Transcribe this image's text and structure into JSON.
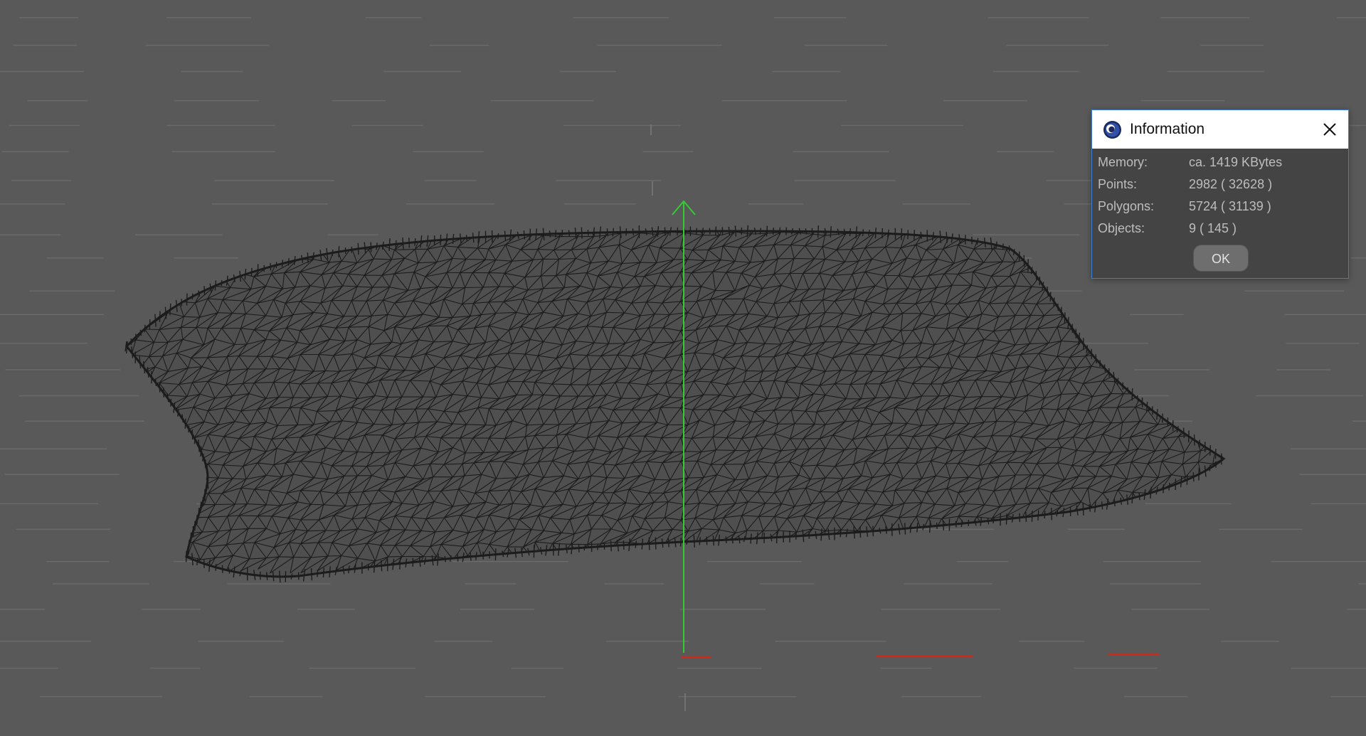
{
  "viewport": {
    "background_color": "#595959",
    "grid_color": "#6a6a6a",
    "mesh_color": "#1c1c1c",
    "y_axis_color": "#33cc33",
    "x_axis_color": "#cc2a1a"
  },
  "info_dialog": {
    "title": "Information",
    "app_icon": "cinema4d-logo-icon",
    "close_icon": "close-icon",
    "rows": [
      {
        "label": "Memory:",
        "value": "ca. 1419 KBytes"
      },
      {
        "label": "Points:",
        "value": "2982 ( 32628 )"
      },
      {
        "label": "Polygons:",
        "value": "5724 ( 31139 )"
      },
      {
        "label": "Objects:",
        "value": "9 ( 145 )"
      }
    ],
    "ok_label": "OK",
    "border_color": "#3c7fd0"
  }
}
